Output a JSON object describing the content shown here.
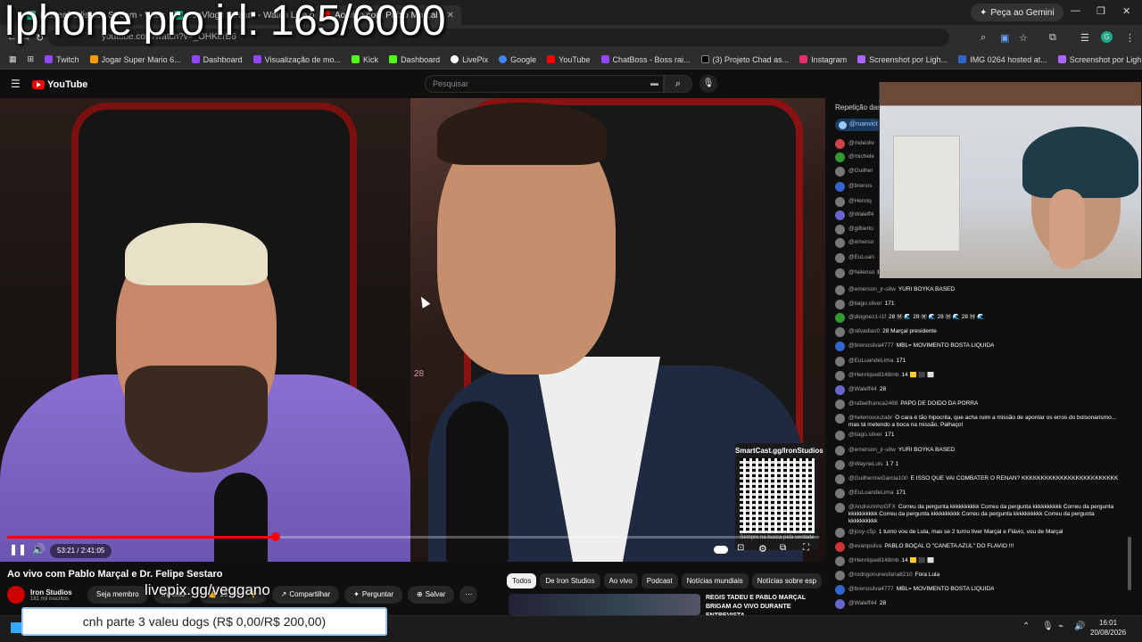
{
  "overlay": {
    "title": "Iphone pro irl: 165/6000",
    "url_text": "livepix.gg/veggano",
    "goal": "cnh parte 3 valeu dogs (R$ 0,00/R$ 200,00)"
  },
  "browser": {
    "tabs": [
      {
        "label": "matteafrodisiaco Stream - Watc",
        "color": "#0c9"
      },
      {
        "label": "JonVlogs Stream - Watch Live o",
        "color": "#0c9"
      },
      {
        "label": "Ao vivo com Pablo Marçal",
        "color": "#f00",
        "active": true
      }
    ],
    "address": "youtube.com/watch?v=_OHKerB6",
    "gemini": "Peça ao Gemini",
    "profile_initial": "G",
    "bookmarks": [
      {
        "label": "Twitch",
        "color": "#9146ff"
      },
      {
        "label": "Jogar Super Mario 6...",
        "color": "#f90"
      },
      {
        "label": "Dashboard",
        "color": "#9146ff"
      },
      {
        "label": "Visualização de mo...",
        "color": "#9146ff"
      },
      {
        "label": "Kick",
        "color": "#53fc18"
      },
      {
        "label": "Dashboard",
        "color": "#53fc18"
      },
      {
        "label": "LivePix",
        "color": "#fff"
      },
      {
        "label": "Google",
        "color": "#4285f4"
      },
      {
        "label": "YouTube",
        "color": "#f00"
      },
      {
        "label": "ChatBoss - Boss rai...",
        "color": "#9146ff"
      },
      {
        "label": "(3) Projeto Chad as...",
        "color": "#000"
      },
      {
        "label": "Instagram",
        "color": "#e1306c"
      },
      {
        "label": "Screenshot por Ligh...",
        "color": "#a6f"
      },
      {
        "label": "IMG 0264 hosted at...",
        "color": "#36c"
      },
      {
        "label": "Screenshot por Ligh...",
        "color": "#a6f"
      }
    ]
  },
  "youtube": {
    "logo": "YouTube",
    "search_placeholder": "Pesquisar",
    "video": {
      "time": "53:21 / 2:41:05",
      "progress": 0.331,
      "qr_label": "SmartCast.gg/IronStudios",
      "qr_sub": "Sempre na busca pela verdade",
      "jersey_number": "28"
    },
    "title": "Ao vivo com Pablo Marçal e Dr. Felipe Sestaro",
    "channel": {
      "name": "Iron Studios",
      "subs": "181 mil inscritos",
      "join": "Seja membro",
      "subscribe": "Inscrito",
      "likes": "15 mil",
      "share": "Compartilhar",
      "ask": "Perguntar",
      "save": "Salvar"
    },
    "chips": [
      "Todos",
      "De Iron Studios",
      "Ao vivo",
      "Podcast",
      "Notícias mundiais",
      "Notícias sobre esp"
    ],
    "rec_title": "REGIS TADEU E PABLO MARÇAL BRIGAM AO VIVO DURANTE ENTREVISTA"
  },
  "chat": {
    "header": "Repetição das",
    "pinned": "@ruanvict",
    "messages": [
      {
        "author": "@mdeoliv",
        "text": "",
        "color": "#c44"
      },
      {
        "author": "@michele",
        "text": "",
        "color": "#393"
      },
      {
        "author": "@Guilher",
        "text": "",
        "color": "#777"
      },
      {
        "author": "@brenos",
        "text": "",
        "color": "#36c"
      },
      {
        "author": "@Henriq",
        "text": "",
        "color": "#777"
      },
      {
        "author": "@Waleff4",
        "text": "",
        "color": "#66c"
      },
      {
        "author": "@gilberto",
        "text": "",
        "color": "#777"
      },
      {
        "author": "@emerso",
        "text": "",
        "color": "#777"
      },
      {
        "author": "@EuLuan",
        "text": "",
        "color": "#777"
      },
      {
        "author": "@helenso",
        "text": "bolsonarismo... mas tá metendo a boca na missão. Palhaço!",
        "color": "#777"
      },
      {
        "author": "@emerson_jr-s8w",
        "text": "YURI BOYKA BASED",
        "color": "#777"
      },
      {
        "author": "@tiago.silver",
        "text": "171",
        "color": "#777"
      },
      {
        "author": "@diogoez1-i1f",
        "text": "28 Ⓜ 🌊 28 Ⓜ 🌊 28 Ⓜ 🌊 28 Ⓜ 🌊",
        "color": "#393"
      },
      {
        "author": "@silvadias0",
        "text": "28 Marçal presidente",
        "color": "#777"
      },
      {
        "author": "@brenosilva4777",
        "text": "MBL= MOVIMENTO BOSTA LÍQUIDA",
        "color": "#36c"
      },
      {
        "author": "@EuLuandeLima",
        "text": "171",
        "color": "#777"
      },
      {
        "author": "@Henrique8148mb",
        "text": "14 🟨 ⬛ ⬜",
        "color": "#777"
      },
      {
        "author": "@Waleff44",
        "text": "28",
        "color": "#66c"
      },
      {
        "author": "@rafaelfranca2468",
        "text": "PAPO DE DOIDO DA PORRA",
        "color": "#777"
      },
      {
        "author": "@helenosouzabr",
        "text": "O cara é tão hipocrita, que acha ruim a missão de apontar os erros do bolsonarismo... mas tá metendo a boca na missão. Palhaço!",
        "color": "#777"
      },
      {
        "author": "@tiago.silver",
        "text": "171",
        "color": "#777"
      },
      {
        "author": "@emerson_jr-s8w",
        "text": "YURI BOYKA BASED",
        "color": "#777"
      },
      {
        "author": "@WayneLuis",
        "text": "1 7 1",
        "color": "#777"
      },
      {
        "author": "@GuilhermeGarcia100",
        "text": "É ISSO QUE VAI COMBATER O RENAN? KKKKKKKKKKKKKKKKKKKKKKKKK",
        "color": "#777"
      },
      {
        "author": "@EuLuandeLima",
        "text": "171",
        "color": "#777"
      },
      {
        "author": "@AndrezinhoGFX",
        "text": "Correu da pergunta kkkkkkkkkk Correu da pergunta kkkkkkkkkk Correu da pergunta kkkkkkkkkk Correu da pergunta kkkkkkkkkk Correu da pergunta kkkkkkkkkk Correu da pergunta kkkkkkkkkk",
        "color": "#777"
      },
      {
        "author": "@josy-c5p",
        "text": "1 turno vou de Lula, mas se 2 turno tiver Marçal e Flávio, vou de Marçal",
        "color": "#777"
      },
      {
        "author": "@evanpsilva",
        "text": "PABLO BOÇAL O \"CANETA AZUL\" DO FLAVIO !!!",
        "color": "#c33"
      },
      {
        "author": "@Henrique8148mb",
        "text": "14 🟨 ⬛ ⬜",
        "color": "#777"
      },
      {
        "author": "@rodrigonunesfaria8210",
        "text": "Fora Lula",
        "color": "#777"
      },
      {
        "author": "@brenosilva4777",
        "text": "MBL= MOVIMENTO BOSTA LÍQUIDA",
        "color": "#36c"
      },
      {
        "author": "@Waleff44",
        "text": "28",
        "color": "#66c"
      }
    ]
  },
  "taskbar": {
    "time": "16:01",
    "date": "20/08/2026"
  }
}
